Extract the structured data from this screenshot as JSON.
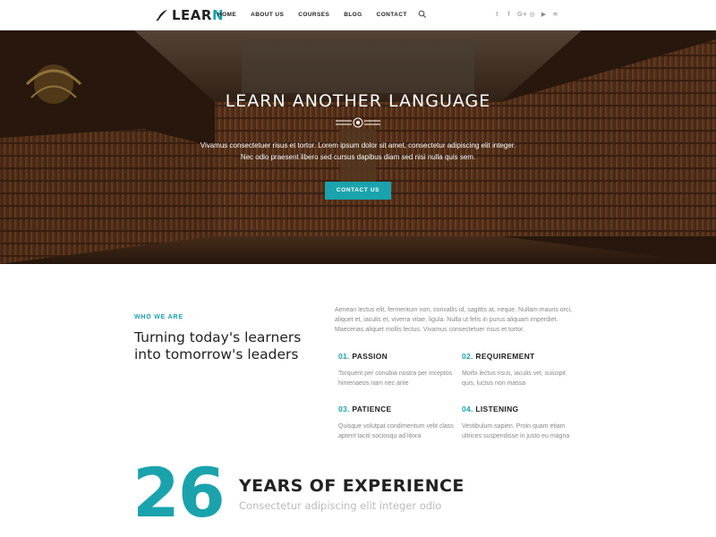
{
  "header": {
    "logo_main": "LEAR",
    "logo_accent": "N",
    "nav": [
      {
        "label": "HOME"
      },
      {
        "label": "ABOUT US"
      },
      {
        "label": "COURSES"
      },
      {
        "label": "BLOG"
      },
      {
        "label": "CONTACT"
      }
    ],
    "search_icon": "search-icon",
    "social": [
      {
        "icon": "twitter-icon",
        "glyph": "t"
      },
      {
        "icon": "facebook-icon",
        "glyph": "f"
      },
      {
        "icon": "google-plus-icon",
        "glyph": "G+"
      },
      {
        "icon": "instagram-icon",
        "glyph": "◎"
      },
      {
        "icon": "youtube-icon",
        "glyph": "▶"
      },
      {
        "icon": "rss-icon",
        "glyph": "≋"
      }
    ]
  },
  "hero": {
    "title": "LEARN ANOTHER LANGUAGE",
    "text_line1": "Vivamus consectetuer risus et tortor. Lorem ipsum dolor sit amet, consectetur adipiscing elit integer.",
    "text_line2": "Nec odio praesent libero sed cursus dapibus diam sed nisi nulla quis sem.",
    "button_label": "CONTACT US"
  },
  "about": {
    "eyebrow": "WHO WE ARE",
    "heading_line1": "Turning today's learners",
    "heading_line2": "into tomorrow's leaders",
    "intro": "Aenean lectus elit, fermentum non, convallis id, sagittis at, neque. Nullam mauris orci, aliquet et, iaculis et, viverra vitae, ligula. Nulla ut felis in purus aliquam imperdiet. Maecenas aliquet mollis lectus. Vivamus consectetuer risus et tortor.",
    "features": [
      {
        "num": "01.",
        "title": "PASSION",
        "desc": "Torquent per conubia nostra per inceptos himenaeos nam nec ante"
      },
      {
        "num": "02.",
        "title": "REQUIREMENT",
        "desc": "Morbi lectus risus, iaculis vel, suscipit quis, luctus non massa"
      },
      {
        "num": "03.",
        "title": "PATIENCE",
        "desc": "Quisque volutpat condimentum velit class aptent taciti sociosqu ad litora"
      },
      {
        "num": "04.",
        "title": "LISTENING",
        "desc": "Vestibulum sapien. Proin quam etiam ultrices suspendisse in justo eu magna"
      }
    ]
  },
  "experience": {
    "number": "26",
    "title": "YEARS OF EXPERIENCE",
    "subtitle": "Consectetur adipiscing elit integer odio"
  },
  "colors": {
    "accent": "#1aa3ad",
    "text_dark": "#222222",
    "text_muted": "#888888"
  }
}
